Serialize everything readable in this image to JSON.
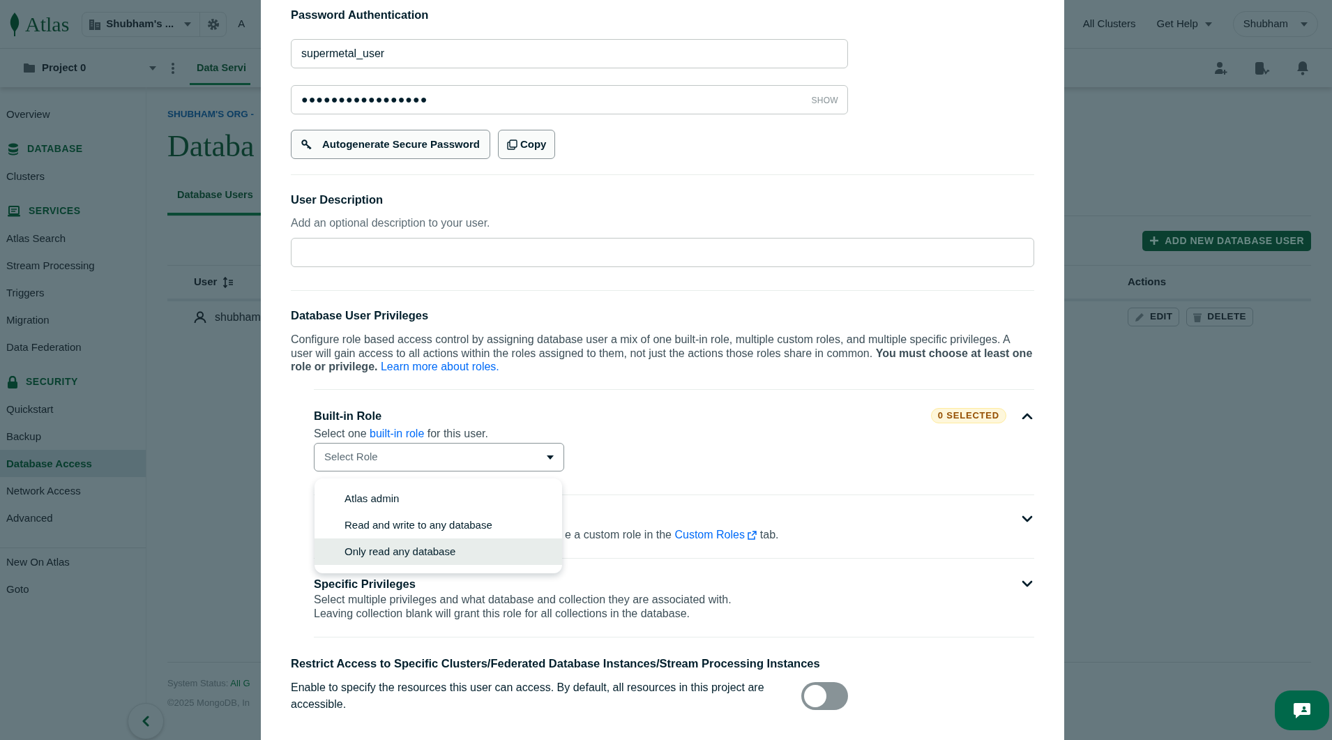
{
  "top_bar": {
    "logo": "Atlas",
    "organization": "Shubham's ...",
    "partial_tab": "A",
    "links": [
      {
        "label": "All Clusters",
        "dropdown": false
      },
      {
        "label": "Get Help",
        "dropdown": true
      }
    ],
    "user": "Shubham"
  },
  "project_bar": {
    "project": "Project 0",
    "tabs": [
      {
        "label": "Data Servi",
        "selected": true
      }
    ]
  },
  "sidebar": {
    "items": [
      {
        "kind": "link",
        "label": "Overview",
        "selected": false
      },
      {
        "kind": "section",
        "label": "DATABASE"
      },
      {
        "kind": "link",
        "label": "Clusters",
        "selected": false
      },
      {
        "kind": "section",
        "label": "SERVICES"
      },
      {
        "kind": "link",
        "label": "Atlas Search",
        "selected": false
      },
      {
        "kind": "link",
        "label": "Stream Processing",
        "selected": false
      },
      {
        "kind": "link",
        "label": "Triggers",
        "selected": false
      },
      {
        "kind": "link",
        "label": "Migration",
        "selected": false
      },
      {
        "kind": "link",
        "label": "Data Federation",
        "selected": false
      },
      {
        "kind": "section",
        "label": "SECURITY"
      },
      {
        "kind": "link",
        "label": "Quickstart",
        "selected": false
      },
      {
        "kind": "link",
        "label": "Backup",
        "selected": false
      },
      {
        "kind": "link",
        "label": "Database Access",
        "selected": true
      },
      {
        "kind": "link",
        "label": "Network Access",
        "selected": false
      },
      {
        "kind": "link",
        "label": "Advanced",
        "selected": false
      }
    ],
    "footer_items": [
      "New On Atlas",
      "Goto"
    ]
  },
  "main": {
    "breadcrumb": "SHUBHAM'S ORG -",
    "title": "Databa",
    "tabs": [
      {
        "label": "Database Users",
        "selected": true
      }
    ],
    "add_button": "ADD NEW DATABASE USER",
    "table": {
      "columns": [
        "User",
        "Actions"
      ],
      "rows": [
        {
          "user": "shubham",
          "actions": [
            "EDIT",
            "DELETE"
          ]
        }
      ]
    },
    "footer": {
      "status_label": "System Status:",
      "status_value": "All G",
      "copyright": "©2025 MongoDB, In"
    }
  },
  "modal": {
    "password_section": {
      "title": "Password Authentication",
      "username": "supermetal_user",
      "password": "●●●●●●●●●●●●●●●●●",
      "show": "SHOW",
      "buttons": [
        "Autogenerate Secure Password",
        "Copy"
      ]
    },
    "description": {
      "title": "User Description",
      "hint": "Add an optional description to your user."
    },
    "privileges": {
      "title": "Database User Privileges",
      "text": "Configure role based access control by assigning database user a mix of one built-in role, multiple custom roles, and multiple specific privileges. A user will gain access to all actions within the roles assigned to them, not just the actions those roles share in common. **You must choose at least one role or privilege.**",
      "link": "Learn more about roles.",
      "sections": [
        {
          "kind": "built_in",
          "title": "Built-in Role",
          "expanded": true,
          "badge": "0 SELECTED",
          "text_before": "Select one ",
          "link": "built-in role",
          "text_after": " for this user.",
          "select_placeholder": "Select Role",
          "options": [
            {
              "label": "Atlas admin",
              "selected": false,
              "highlighted": false
            },
            {
              "label": "Read and write to any database",
              "selected": false,
              "highlighted": false
            },
            {
              "label": "Only read any database",
              "selected": false,
              "highlighted": true
            }
          ]
        },
        {
          "kind": "custom",
          "expanded": false,
          "text_before": "e a custom role in the ",
          "link": "Custom Roles",
          "text_after": " tab."
        },
        {
          "kind": "specific",
          "title": "Specific Privileges",
          "expanded": false,
          "lines": [
            "Select multiple privileges and what database and collection they are associated with.",
            "Leaving collection blank will grant this role for all collections in the database."
          ]
        }
      ]
    },
    "restrict": {
      "title": "Restrict Access to Specific Clusters/Federated Database Instances/Stream Processing Instances",
      "text": "Enable to specify the resources this user can access. By default, all resources in this project are accessible.",
      "on": false
    }
  }
}
